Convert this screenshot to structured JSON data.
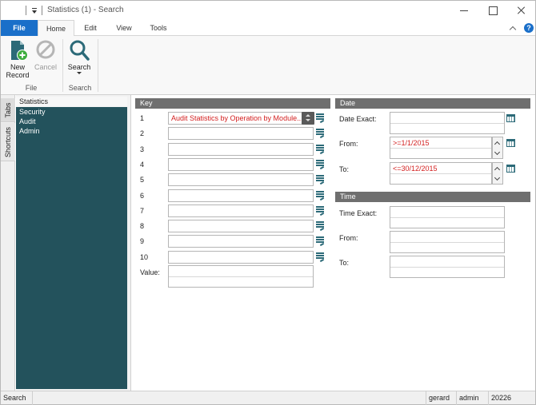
{
  "window": {
    "title": "Statistics (1) - Search"
  },
  "ribbon": {
    "tabs": [
      "File",
      "Home",
      "Edit",
      "View",
      "Tools"
    ],
    "help": "?",
    "buttons": {
      "new_record": "New\nRecord",
      "cancel": "Cancel",
      "search": "Search"
    },
    "groups": {
      "file": "File",
      "search": "Search"
    }
  },
  "side_tabs": {
    "tabs": "Tabs",
    "shortcuts": "Shortcuts"
  },
  "tree": {
    "header": "Statistics",
    "items": [
      "Security",
      "Audit",
      "Admin"
    ]
  },
  "key": {
    "header": "Key",
    "rows": [
      {
        "label": "1",
        "value": "Audit Statistics by Operation by Module..."
      },
      {
        "label": "2",
        "value": ""
      },
      {
        "label": "3",
        "value": ""
      },
      {
        "label": "4",
        "value": ""
      },
      {
        "label": "5",
        "value": ""
      },
      {
        "label": "6",
        "value": ""
      },
      {
        "label": "7",
        "value": ""
      },
      {
        "label": "8",
        "value": ""
      },
      {
        "label": "9",
        "value": ""
      },
      {
        "label": "10",
        "value": ""
      }
    ],
    "value_label": "Value:"
  },
  "date": {
    "header": "Date",
    "exact_label": "Date Exact:",
    "from_label": "From:",
    "from_value": ">=1/1/2015",
    "to_label": "To:",
    "to_value": "<=30/12/2015"
  },
  "time": {
    "header": "Time",
    "exact_label": "Time Exact:",
    "from_label": "From:",
    "to_label": "To:"
  },
  "status": {
    "mode": "Search",
    "user": "gerard",
    "role": "admin",
    "code": "20226"
  },
  "colors": {
    "accent": "#1a6fc9",
    "tree_bg": "#23525c",
    "header_bg": "#6f6f6f",
    "criteria_text": "#d32020"
  }
}
